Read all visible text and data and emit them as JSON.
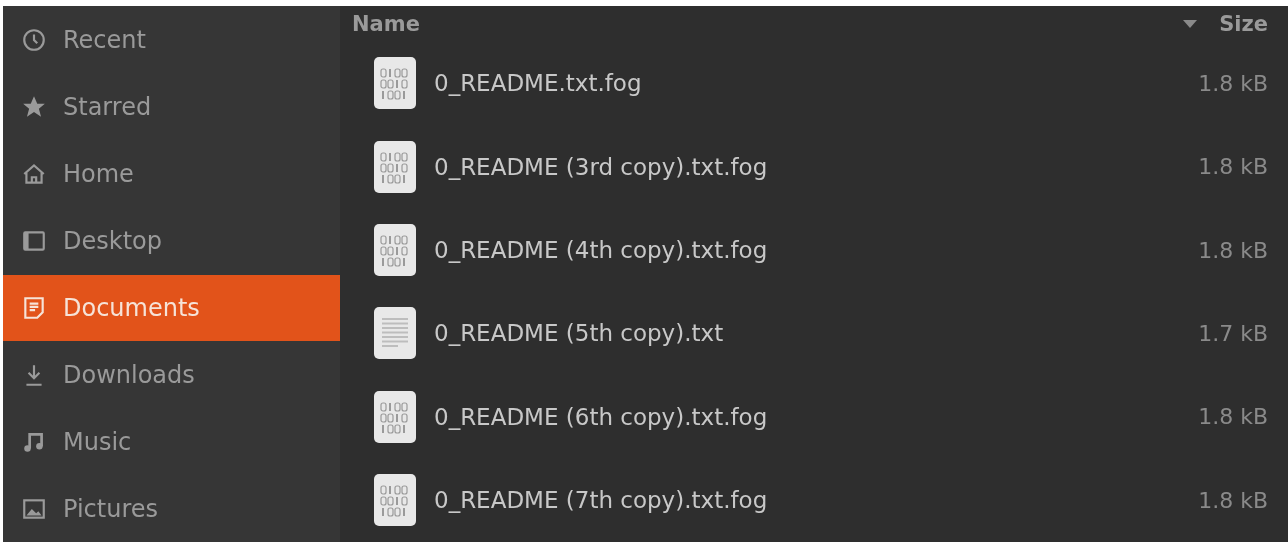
{
  "sidebar": {
    "items": [
      {
        "label": "Recent",
        "kind": "recent",
        "selected": false
      },
      {
        "label": "Starred",
        "kind": "star",
        "selected": false
      },
      {
        "label": "Home",
        "kind": "home",
        "selected": false
      },
      {
        "label": "Desktop",
        "kind": "desktop",
        "selected": false
      },
      {
        "label": "Documents",
        "kind": "documents",
        "selected": true
      },
      {
        "label": "Downloads",
        "kind": "downloads",
        "selected": false
      },
      {
        "label": "Music",
        "kind": "music",
        "selected": false
      },
      {
        "label": "Pictures",
        "kind": "pictures",
        "selected": false
      }
    ]
  },
  "file_list": {
    "columns": [
      {
        "label": "Name",
        "sorted": false
      },
      {
        "label": "Size",
        "sorted": true
      }
    ],
    "rows": [
      {
        "name": "0_README.txt.fog",
        "size": "1.8 kB",
        "kind": "binary"
      },
      {
        "name": "0_README (3rd copy).txt.fog",
        "size": "1.8 kB",
        "kind": "binary"
      },
      {
        "name": "0_README (4th copy).txt.fog",
        "size": "1.8 kB",
        "kind": "binary"
      },
      {
        "name": "0_README (5th copy).txt",
        "size": "1.7 kB",
        "kind": "text"
      },
      {
        "name": "0_README (6th copy).txt.fog",
        "size": "1.8 kB",
        "kind": "binary"
      },
      {
        "name": "0_README (7th copy).txt.fog",
        "size": "1.8 kB",
        "kind": "binary"
      }
    ]
  }
}
